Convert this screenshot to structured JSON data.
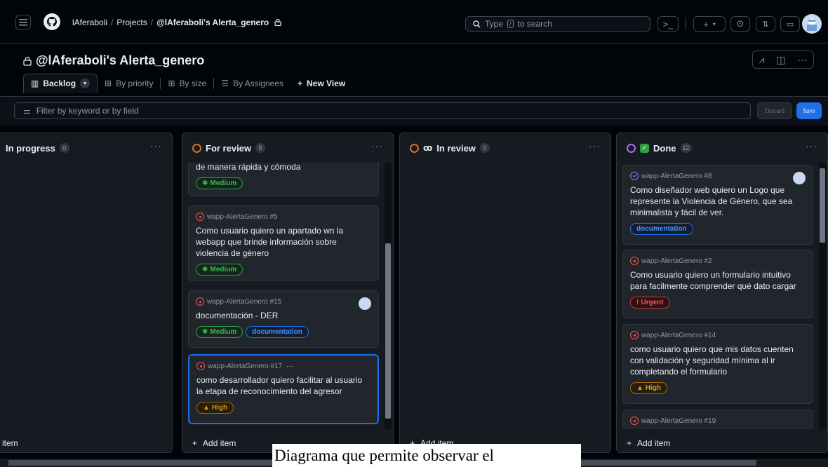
{
  "header": {
    "owner": "lAferaboli",
    "section": "Projects",
    "project": "@lAferaboli's Alerta_genero",
    "search_text": "Type",
    "search_key": "/",
    "search_suffix": "to search"
  },
  "project": {
    "title": "@lAferaboli's Alerta_genero",
    "tabs": [
      {
        "label": "Backlog"
      },
      {
        "label": "By priority"
      },
      {
        "label": "By size"
      },
      {
        "label": "By Assignees"
      },
      {
        "label": "New View"
      }
    ]
  },
  "filter": {
    "placeholder": "Filter by keyword or by field",
    "discard": "Discard",
    "save": "Save"
  },
  "columns": [
    {
      "name": "In progress",
      "count": "0",
      "add_item": "item"
    },
    {
      "name": "For review",
      "count": "5",
      "status_color": "#db6d28",
      "add_item": "Add item",
      "cards": [
        {
          "title": "de manera rápida y cómoda",
          "labels": [
            "Medium"
          ]
        },
        {
          "meta": "wapp-AlertaGenero #5",
          "title": "Como usuario quiero un apartado wn la webapp que brinde información sobre violencia de género",
          "labels": [
            "Medium"
          ]
        },
        {
          "meta": "wapp-AlertaGenero #15",
          "title": "documentación - DER",
          "labels": [
            "Medium",
            "documentation"
          ]
        },
        {
          "meta": "wapp-AlertaGenero #17",
          "more": "···",
          "title": "como desarrollador quiero facilitar al usuario la etapa de reconocimiento del agresor",
          "labels": [
            "High"
          ]
        }
      ]
    },
    {
      "name": "In review",
      "count": "0",
      "status_color": "#db6d28",
      "add_item": "Add item"
    },
    {
      "name": "Done",
      "count": "12",
      "status_color": "#a371f7",
      "add_item": "Add item",
      "cards": [
        {
          "meta": "wapp-AlertaGenero #8",
          "title": "Como diseñador web quiero un Logo que represente la Violencia de Género, que sea minimalista y fácil de ver.",
          "labels": [
            "documentation"
          ]
        },
        {
          "meta": "wapp-AlertaGenero #2",
          "title": "Como usuario quiero un formulario intuitivo para facilmente comprender qué dato cargar",
          "labels": [
            "Urgent"
          ]
        },
        {
          "meta": "wapp-AlertaGenero #14",
          "title": "como usuario quiero que mis datos cuenten con validación y seguridad mínima al ir completando el formulario",
          "labels": [
            "High"
          ]
        },
        {
          "meta": "wapp-AlertaGenero #19"
        }
      ]
    }
  ],
  "caption": "Diagrama que permite observar el"
}
